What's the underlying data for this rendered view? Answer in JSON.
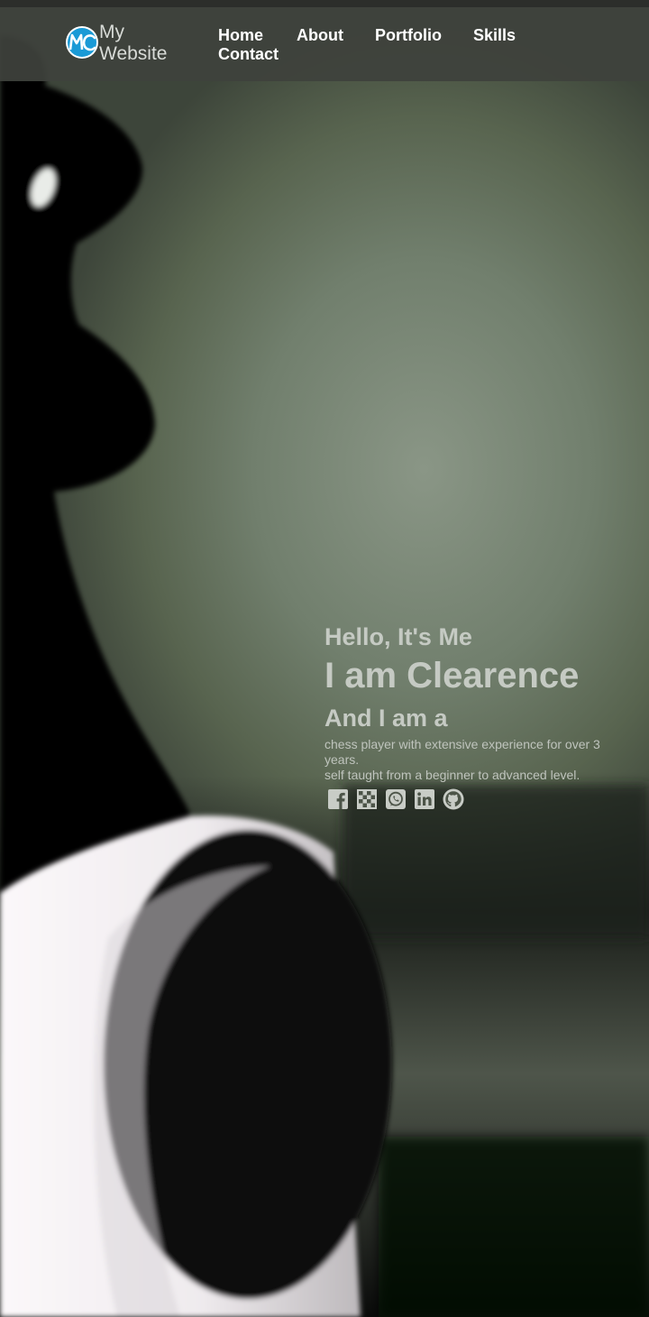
{
  "brand": {
    "line1": "My",
    "line2": "Website",
    "logo_icon": "mc-logo-icon",
    "logo_color": "#1a9ad6"
  },
  "nav": {
    "items": [
      {
        "label": "Home"
      },
      {
        "label": "About"
      },
      {
        "label": "Portfolio"
      },
      {
        "label": "Skills"
      },
      {
        "label": "Contact"
      }
    ]
  },
  "hero": {
    "greeting": "Hello, It's Me",
    "name": "I am Clearence",
    "role": "And I am a",
    "desc_line1": "chess player with extensive experience for over 3 years.",
    "desc_line2": "self taught from a beginner to advanced level."
  },
  "social": {
    "icons": [
      "facebook-icon",
      "chess-board-icon",
      "whatsapp-icon",
      "linkedin-icon",
      "github-icon"
    ],
    "color": "#c8ccc6"
  }
}
